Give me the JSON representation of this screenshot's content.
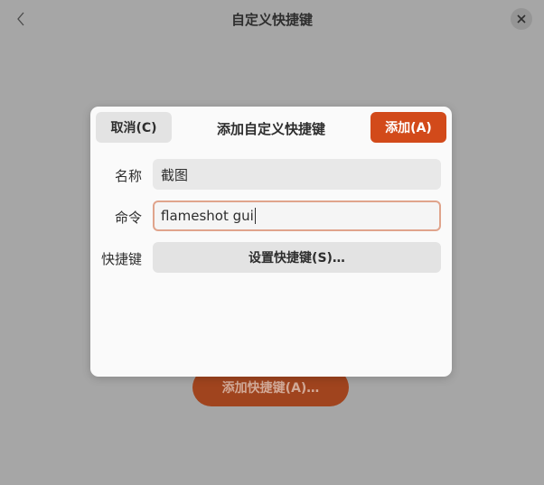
{
  "window": {
    "title": "自定义快捷键",
    "background_button_label": "添加快捷键(A)…"
  },
  "dialog": {
    "title": "添加自定义快捷键",
    "cancel_label": "取消(C)",
    "add_label": "添加(A)",
    "name_label": "名称",
    "name_value": "截图",
    "command_label": "命令",
    "command_value": "flameshot gui",
    "shortcut_label": "快捷键",
    "shortcut_button_label": "设置快捷键(S)…"
  },
  "colors": {
    "accent": "#d24a1a",
    "focus_border": "#e0a48c",
    "backdrop": "#a6a6a6"
  },
  "icons": {
    "back": "chevron-left-icon",
    "close": "close-icon"
  }
}
